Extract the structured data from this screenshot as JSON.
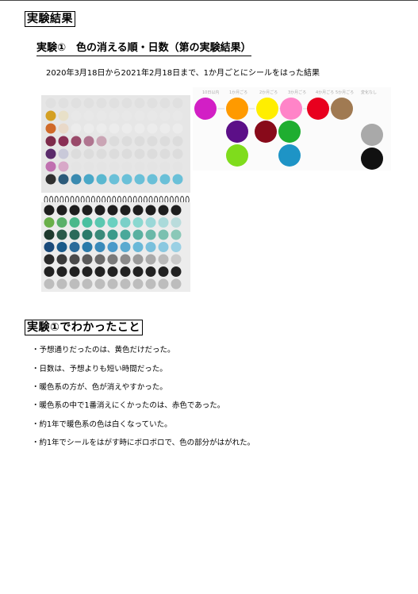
{
  "section1_title": "実験結果",
  "exp1_title": "実験①　色の消える順・日数（第の実験結果）",
  "exp1_intro": "2020年3月18日から2021年2月18日まで、1か月ごとにシールをはった結果",
  "photo_chart": {
    "labels": [
      "10日以内",
      "1か月ごろ",
      "2か月ごろ",
      "3か月ごろ",
      "4か月ごろ",
      "5か月ごろ",
      "変化なし"
    ],
    "row1": [
      "#d21fc5",
      "#ff9a00",
      "#ffee00",
      "#ff84c8",
      "#e8001e",
      "#a07a52"
    ],
    "row2": [
      "#5c0f88",
      "#880a1a",
      "#1fae30"
    ],
    "row3": [
      "#7fdc1c",
      "#1e94c6"
    ],
    "unchanged": [
      "#a9a9a9",
      "#111111"
    ]
  },
  "section2_title": "実験①でわかったこと",
  "findings": [
    "・予想通りだったのは、黄色だけだった。",
    "・日数は、予想よりも短い時間だった。",
    "・暖色系の方が、色が消えやすかった。",
    "・暖色系の中で1番消えにくかったのは、赤色であった。",
    "・約1年で暖色系の色は白くなっていた。",
    "・約1年でシールをはがす時にボロボロで、色の部分がはがれた。"
  ]
}
